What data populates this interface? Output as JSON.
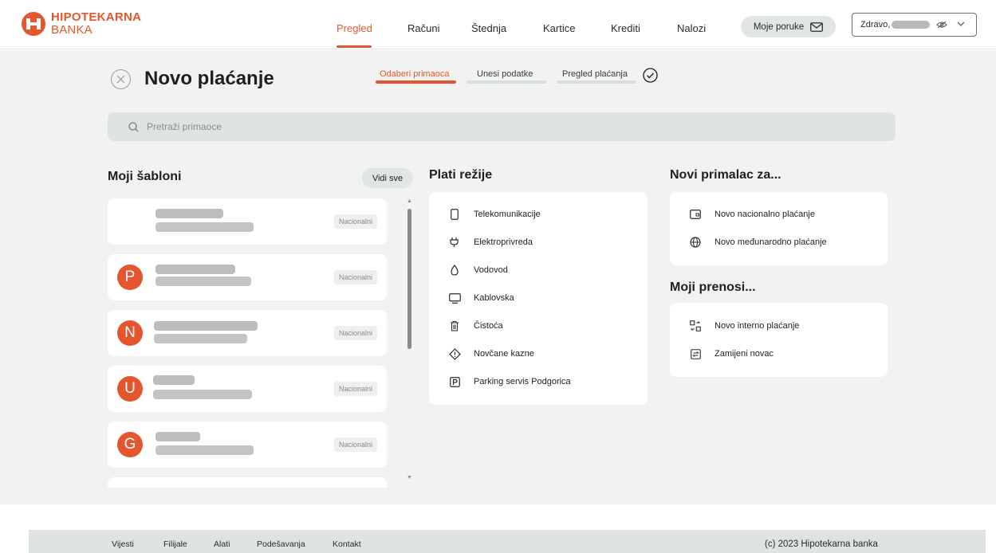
{
  "brand": {
    "name_line1": "HIPOTEKARNA",
    "name_line2": "BANKA",
    "accent_color": "#e4572e"
  },
  "nav": {
    "items": [
      {
        "label": "Pregled",
        "active": true
      },
      {
        "label": "Računi",
        "active": false
      },
      {
        "label": "Štednja",
        "active": false
      },
      {
        "label": "Kartice",
        "active": false
      },
      {
        "label": "Krediti",
        "active": false
      },
      {
        "label": "Nalozi",
        "active": false
      }
    ],
    "messages_label": "Moje poruke",
    "greeting": "Zdravo,"
  },
  "page": {
    "title": "Novo plaćanje",
    "steps": [
      {
        "label": "Odaberi primaoca",
        "active": true
      },
      {
        "label": "Unesi podatke",
        "active": false
      },
      {
        "label": "Pregled plaćanja",
        "active": false
      }
    ],
    "search_placeholder": "Pretraži primaoce"
  },
  "templates": {
    "title": "Moji šabloni",
    "see_all_label": "Vidi sve",
    "items": [
      {
        "initial": "",
        "badge": "Nacionalni"
      },
      {
        "initial": "P",
        "badge": "Nacionalni"
      },
      {
        "initial": "N",
        "badge": "Nacionalni"
      },
      {
        "initial": "U",
        "badge": "Nacionalni"
      },
      {
        "initial": "G",
        "badge": "Nacionalni"
      },
      {
        "initial": "",
        "badge": ""
      }
    ]
  },
  "bills": {
    "title": "Plati režije",
    "items": [
      {
        "label": "Telekomunikacije",
        "icon": "phone-icon"
      },
      {
        "label": "Elektroprivreda",
        "icon": "plug-icon"
      },
      {
        "label": "Vodovod",
        "icon": "water-drop-icon"
      },
      {
        "label": "Kablovska",
        "icon": "tv-icon"
      },
      {
        "label": "Čistoća",
        "icon": "trash-icon"
      },
      {
        "label": "Novčane kazne",
        "icon": "warning-icon"
      },
      {
        "label": "Parking servis Podgorica",
        "icon": "parking-icon"
      }
    ]
  },
  "new_recipient": {
    "title": "Novi primalac za...",
    "items": [
      {
        "label": "Novo nacionalno plaćanje",
        "icon": "wallet-icon"
      },
      {
        "label": "Novo međunarodno plaćanje",
        "icon": "globe-icon"
      }
    ]
  },
  "transfers": {
    "title": "Moji prenosi...",
    "items": [
      {
        "label": "Novo interno plaćanje",
        "icon": "internal-transfer-icon"
      },
      {
        "label": "Zamijeni novac",
        "icon": "exchange-icon"
      }
    ]
  },
  "footer": {
    "links": [
      "Vijesti",
      "Filijale",
      "Alati",
      "Podešavanja",
      "Kontakt"
    ],
    "copyright": "(c) 2023 Hipotekarna banka"
  }
}
